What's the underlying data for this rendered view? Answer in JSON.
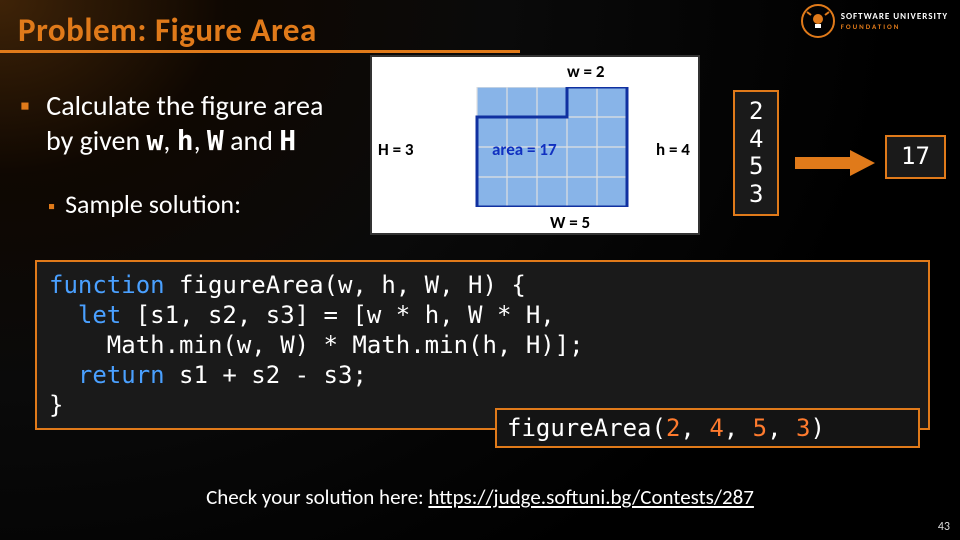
{
  "title": "Problem: Figure Area",
  "logo": {
    "line1": "SOFTWARE UNIVERSITY",
    "line2": "FOUNDATION"
  },
  "bullet": {
    "line1": "Calculate the figure area",
    "line2_pre": "by given ",
    "w": "w",
    "h": "h",
    "W": "W",
    "H": "H",
    "and": " and ",
    "comma": ", "
  },
  "subbullet": "Sample solution:",
  "figure": {
    "w2": "w = 2",
    "h3": "H = 3",
    "area": "area = 17",
    "h4": "h = 4",
    "w5": "W = 5"
  },
  "io": {
    "input": "2\n4\n5\n3",
    "output": "17"
  },
  "code": "function figureArea(w, h, W, H) {\n  let [s1, s2, s3] = [w * h, W * H,\n    Math.min(w, W) * Math.min(h, H)];\n  return s1 + s2 - s3;\n}",
  "call": {
    "fn": "figureArea(",
    "args": [
      "2",
      "4",
      "5",
      "3"
    ],
    "close": ")"
  },
  "footer": {
    "text": "Check your solution here: ",
    "link": "https://judge.softuni.bg/Contests/287"
  },
  "pagenum": "43"
}
